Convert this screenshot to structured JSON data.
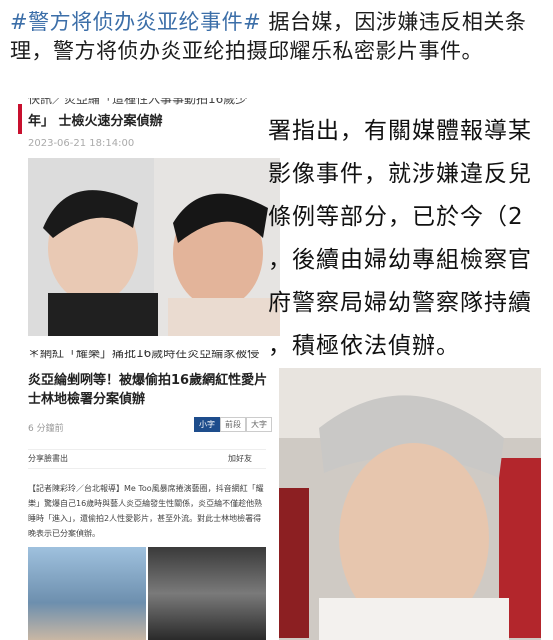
{
  "post": {
    "hashtag": "#警方将侦办炎亚纶事件#",
    "text": " 据台媒，因涉嫌违反相关条理，警方将侦办炎亚纶拍摄邱耀乐私密影片事件。"
  },
  "article_top": {
    "cut_line": "快訊／炎亞綸「這種性入事事動拍16歲少",
    "headline": "年」 士檢火速分案偵辦",
    "date": "2023-06-21 18:14:00",
    "bottom_cut": "＊網紅「耀樂」痛批16歲時在炎亞綸家被侵"
  },
  "zoom_lines": [
    "署指出，有關媒體報導某",
    "影像事件，就涉嫌違反兒",
    "條例等部分，已於今（2",
    "，後續由婦幼專組檢察官",
    "府警察局婦幼警察隊持續",
    "，積極依法偵辦。"
  ],
  "article_bottom": {
    "title": "炎亞綸剉咧等！被爆偷拍16歲網紅性愛片 士林地檢署分案偵辦",
    "views": "6 分鐘前",
    "size_options": [
      "小字",
      "前段",
      "大字"
    ],
    "share_label": "分享臉書出",
    "add_friend": "加好友",
    "body": "【記者陳彩玲／台北報導】Me Too風暴席捲演藝圈，抖音網紅「耀樂」驚爆自己16歲時與藝人炎亞綸發生性關係，炎亞綸不僅趁他熟睡時「進入」，還偷拍2人性愛影片，甚至外流。對此士林地檢署得晚表示已分案偵辦。"
  },
  "colors": {
    "hashtag": "#3b6ea8",
    "accent_red": "#c8102e",
    "size_active": "#1e4d8c"
  }
}
